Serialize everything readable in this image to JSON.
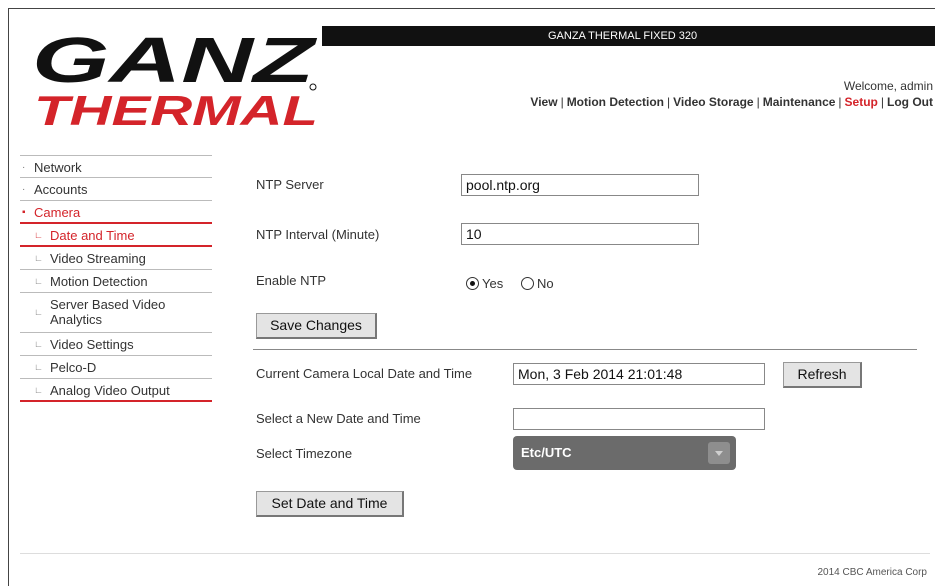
{
  "header": {
    "device_name": "GANZA THERMAL FIXED 320",
    "logo_top": "GANZ",
    "logo_bottom": "THERMAL",
    "welcome": "Welcome, admin",
    "nav": {
      "view": "View",
      "motion_detection": "Motion Detection",
      "video_storage": "Video Storage",
      "maintenance": "Maintenance",
      "setup": "Setup",
      "log_out": "Log Out",
      "separator": "|"
    }
  },
  "sidebar": {
    "network": "Network",
    "accounts": "Accounts",
    "camera": "Camera",
    "date_and_time": "Date and Time",
    "video_streaming": "Video Streaming",
    "motion_detection": "Motion Detection",
    "server_based_video_analytics_l1": "Server Based Video",
    "server_based_video_analytics_l2": "Analytics",
    "video_settings": "Video Settings",
    "pelco_d": "Pelco-D",
    "analog_video_output": "Analog Video Output"
  },
  "ntp": {
    "server_label": "NTP Server",
    "server_value": "pool.ntp.org",
    "interval_label": "NTP Interval (Minute)",
    "interval_value": "10",
    "enable_label": "Enable NTP",
    "yes_label": "Yes",
    "no_label": "No",
    "enabled": "Yes",
    "save_button": "Save Changes"
  },
  "datetime": {
    "current_label": "Current Camera Local Date and Time",
    "current_value": "Mon, 3 Feb 2014 21:01:48",
    "refresh_button": "Refresh",
    "new_label": "Select a New Date and Time",
    "new_value": "",
    "timezone_label": "Select Timezone",
    "timezone_value": "Etc/UTC",
    "set_button": "Set Date and Time"
  },
  "footer": {
    "copyright": "2014 CBC America Corp"
  },
  "colors": {
    "accent_red": "#d4242a",
    "topbar": "#111111",
    "timezone_bg": "#6b6b6b"
  }
}
